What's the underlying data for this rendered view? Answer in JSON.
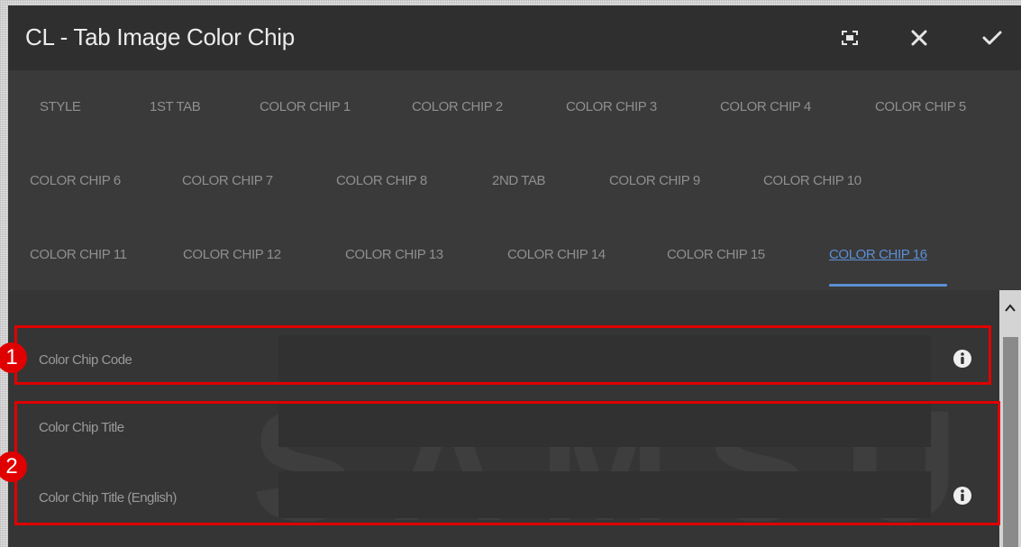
{
  "dialog": {
    "title": "CL - Tab Image Color Chip",
    "buttons": {
      "fullscreen": "fullscreen-icon",
      "cancel": "close-icon",
      "confirm": "checkmark-icon"
    }
  },
  "tabs": {
    "row1": [
      "STYLE",
      "1ST TAB",
      "COLOR CHIP 1",
      "COLOR CHIP 2",
      "COLOR CHIP 3",
      "COLOR CHIP 4",
      "COLOR CHIP 5"
    ],
    "row2": [
      "COLOR CHIP 6",
      "COLOR CHIP 7",
      "COLOR CHIP 8",
      "2ND TAB",
      "COLOR CHIP 9",
      "COLOR CHIP 10"
    ],
    "row3": [
      "COLOR CHIP 11",
      "COLOR CHIP 12",
      "COLOR CHIP 13",
      "COLOR CHIP 14",
      "COLOR CHIP 15",
      "COLOR CHIP 16"
    ],
    "active": "COLOR CHIP 16"
  },
  "fields": [
    {
      "label": "Color Chip Code",
      "value": "",
      "info_icon": "info-icon"
    },
    {
      "label": "Color Chip Title",
      "value": ""
    },
    {
      "label": "Color Chip Title (English)",
      "value": "",
      "info_icon": "info-icon"
    }
  ],
  "watermark": "SAMSUNG",
  "callouts": [
    "1",
    "2"
  ],
  "colors": {
    "accent": "#5c8fd6",
    "callout": "#e00000",
    "titlebar": "#2f2f2f",
    "panel": "#3a3a3a"
  }
}
